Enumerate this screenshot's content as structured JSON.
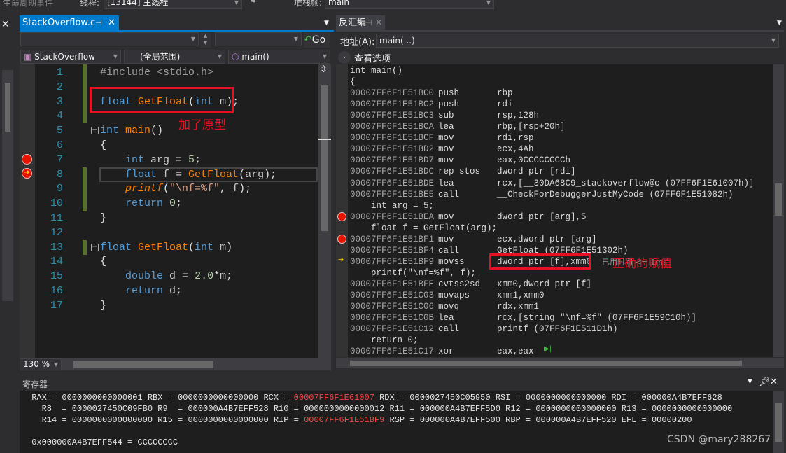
{
  "toolbar": {
    "lifecycle_label": "生命周期事件",
    "thread_label": "线程:",
    "thread_value": "[13144] 主线程",
    "stackframe_label": "堆栈帧:",
    "stackframe_value": "main"
  },
  "editor": {
    "tab_label": "StackOverflow.c",
    "go_label": "Go",
    "project_combo": "StackOverflow",
    "scope_combo": "(全局范围)",
    "function_combo": "main()",
    "zoom": "130 %",
    "annotation": "加了原型",
    "lines": [
      {
        "n": "1",
        "segs": [
          [
            "#include <stdio.h>",
            "pp"
          ]
        ]
      },
      {
        "n": "2",
        "segs": []
      },
      {
        "n": "3",
        "segs": [
          [
            "float ",
            "kw"
          ],
          [
            "GetFloat",
            "fn"
          ],
          [
            "(",
            "tx"
          ],
          [
            "int ",
            "kw"
          ],
          [
            "m",
            "id"
          ],
          [
            ");",
            "tx"
          ]
        ]
      },
      {
        "n": "4",
        "segs": []
      },
      {
        "n": "5",
        "segs": [
          [
            "int ",
            "kw"
          ],
          [
            "main",
            "fn"
          ],
          [
            "()",
            "tx"
          ]
        ]
      },
      {
        "n": "6",
        "segs": [
          [
            "{",
            "tx"
          ]
        ]
      },
      {
        "n": "7",
        "segs": [
          [
            "    int ",
            "kw"
          ],
          [
            "arg",
            "id"
          ],
          [
            " = ",
            "tx"
          ],
          [
            "5",
            "nm"
          ],
          [
            ";",
            "tx"
          ]
        ]
      },
      {
        "n": "8",
        "segs": [
          [
            "    float ",
            "kw"
          ],
          [
            "f",
            "id"
          ],
          [
            " = ",
            "tx"
          ],
          [
            "GetFloat",
            "fn"
          ],
          [
            "(",
            "tx"
          ],
          [
            "arg",
            "id"
          ],
          [
            ");",
            "tx"
          ]
        ]
      },
      {
        "n": "9",
        "segs": [
          [
            "    printf",
            "it"
          ],
          [
            "(",
            "tx"
          ],
          [
            "\"\\nf=%f\"",
            "st"
          ],
          [
            ", ",
            "tx"
          ],
          [
            "f",
            "id"
          ],
          [
            ");",
            "tx"
          ]
        ]
      },
      {
        "n": "10",
        "segs": [
          [
            "    return ",
            "kw"
          ],
          [
            "0",
            "nm"
          ],
          [
            ";",
            "tx"
          ]
        ]
      },
      {
        "n": "11",
        "segs": [
          [
            "}",
            "tx"
          ]
        ]
      },
      {
        "n": "12",
        "segs": []
      },
      {
        "n": "13",
        "segs": [
          [
            "float ",
            "kw"
          ],
          [
            "GetFloat",
            "fn"
          ],
          [
            "(",
            "tx"
          ],
          [
            "int ",
            "kw"
          ],
          [
            "m",
            "id"
          ],
          [
            ")",
            "tx"
          ]
        ]
      },
      {
        "n": "14",
        "segs": [
          [
            "{",
            "tx"
          ]
        ]
      },
      {
        "n": "15",
        "segs": [
          [
            "    double ",
            "kw"
          ],
          [
            "d",
            "id"
          ],
          [
            " = ",
            "tx"
          ],
          [
            "2.0",
            "nm"
          ],
          [
            "*",
            "tx"
          ],
          [
            "m",
            "id"
          ],
          [
            ";",
            "tx"
          ]
        ]
      },
      {
        "n": "16",
        "segs": [
          [
            "    return ",
            "kw"
          ],
          [
            "d",
            "id"
          ],
          [
            ";",
            "tx"
          ]
        ]
      },
      {
        "n": "17",
        "segs": [
          [
            "}",
            "tx"
          ]
        ]
      }
    ]
  },
  "disasm": {
    "tab_label": "反汇编",
    "address_label": "地址(A):",
    "address_value": "main(...)",
    "view_options": "查看选项",
    "annotation": "正确的赋值",
    "hint": "已用时间 <= 1ms",
    "rows": [
      {
        "src": "int main()"
      },
      {
        "src": "{"
      },
      {
        "a": "00007FF6F1E51BC0",
        "m": "push",
        "o": "rbp"
      },
      {
        "a": "00007FF6F1E51BC2",
        "m": "push",
        "o": "rdi"
      },
      {
        "a": "00007FF6F1E51BC3",
        "m": "sub",
        "o": "rsp,128h"
      },
      {
        "a": "00007FF6F1E51BCA",
        "m": "lea",
        "o": "rbp,[rsp+20h]"
      },
      {
        "a": "00007FF6F1E51BCF",
        "m": "mov",
        "o": "rdi,rsp"
      },
      {
        "a": "00007FF6F1E51BD2",
        "m": "mov",
        "o": "ecx,4Ah"
      },
      {
        "a": "00007FF6F1E51BD7",
        "m": "mov",
        "o": "eax,0CCCCCCCCh"
      },
      {
        "a": "00007FF6F1E51BDC",
        "m": "rep stos",
        "o": "dword ptr [rdi]"
      },
      {
        "a": "00007FF6F1E51BDE",
        "m": "lea",
        "o": "rcx,[__30DA68C9_stackoverflow@c (07FF6F1E61007h)]"
      },
      {
        "a": "00007FF6F1E51BE5",
        "m": "call",
        "o": "__CheckForDebuggerJustMyCode (07FF6F1E51082h)"
      },
      {
        "src": "    int arg = 5;"
      },
      {
        "a": "00007FF6F1E51BEA",
        "m": "mov",
        "o": "dword ptr [arg],5",
        "bp": true
      },
      {
        "src": "    float f = GetFloat(arg);"
      },
      {
        "a": "00007FF6F1E51BF1",
        "m": "mov",
        "o": "ecx,dword ptr [arg]",
        "bp": true
      },
      {
        "a": "00007FF6F1E51BF4",
        "m": "call",
        "o": "GetFloat (07FF6F1E51302h)"
      },
      {
        "a": "00007FF6F1E51BF9",
        "m": "movss",
        "o": "dword ptr [f],xmm0",
        "cur": true
      },
      {
        "src": "    printf(\"\\nf=%f\", f);"
      },
      {
        "a": "00007FF6F1E51BFE",
        "m": "cvtss2sd",
        "o": "xmm0,dword ptr [f]"
      },
      {
        "a": "00007FF6F1E51C03",
        "m": "movaps",
        "o": "xmm1,xmm0"
      },
      {
        "a": "00007FF6F1E51C06",
        "m": "movq",
        "o": "rdx,xmm1"
      },
      {
        "a": "00007FF6F1E51C0B",
        "m": "lea",
        "o": "rcx,[string \"\\nf=%f\" (07FF6F1E59C10h)]"
      },
      {
        "a": "00007FF6F1E51C12",
        "m": "call",
        "o": "printf (07FF6F1E511D1h)"
      },
      {
        "src": "    return 0;"
      },
      {
        "a": "00007FF6F1E51C17",
        "m": "xor",
        "o": "eax,eax"
      }
    ]
  },
  "registers": {
    "title": "寄存器",
    "lines": [
      [
        [
          " RAX = 0000000000000001 RBX = 0000000000000000 RCX = ",
          ""
        ],
        [
          "00007FF6F1E61007",
          "red"
        ],
        [
          " RDX = 0000027450C05950 RSI = 0000000000000000 RDI = 000000A4B7EFF628",
          ""
        ]
      ],
      [
        [
          "   R8  = 0000027450C09FB0 R9  = 000000A4B7EFF528 R10 = 0000000000000012 R11 = 000000A4B7EFF5D0 R12 = 0000000000000000 R13 = 0000000000000000",
          ""
        ]
      ],
      [
        [
          "   R14 = 0000000000000000 R15 = 0000000000000000 RIP = ",
          ""
        ],
        [
          "00007FF6F1E51BF9",
          "red"
        ],
        [
          " RSP = 000000A4B7EFF500 RBP = 000000A4B7EFF520 EFL = 00000200",
          ""
        ]
      ],
      [
        [
          "",
          ""
        ]
      ],
      [
        [
          " 0x000000A4B7EFF544 = CCCCCCCC",
          ""
        ]
      ]
    ]
  },
  "watermark": "CSDN @mary288267",
  "colors": {
    "accent": "#007acc",
    "annotation": "#e81123",
    "breakpoint": "#e51400",
    "changed_register": "#f04848"
  }
}
